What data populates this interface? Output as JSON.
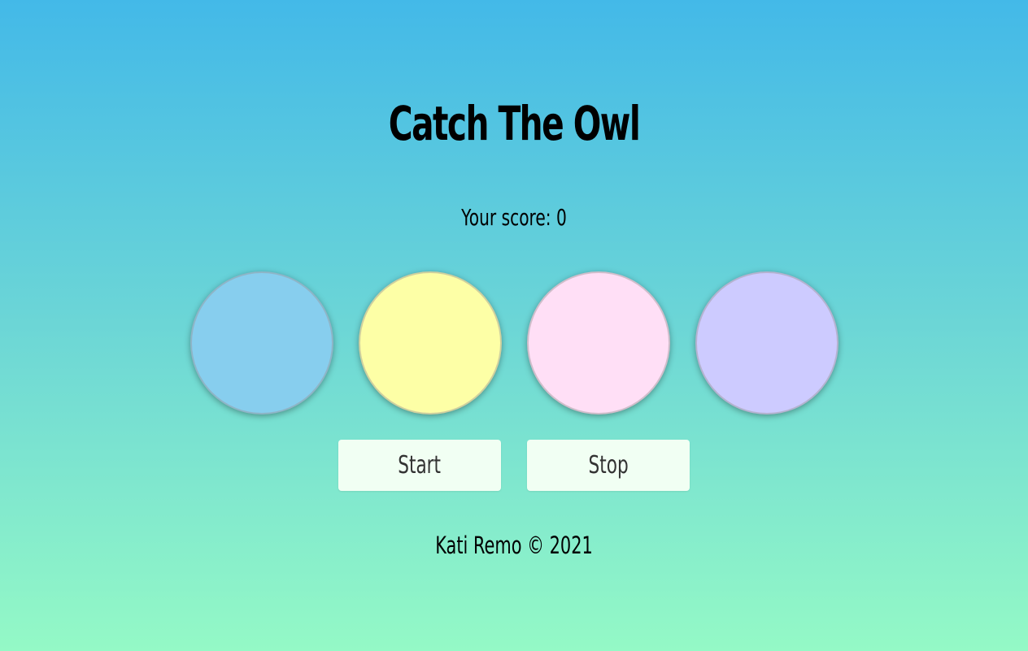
{
  "game": {
    "title": "Catch The Owl",
    "score_label": "Your score:",
    "score_value": 0,
    "circles": [
      {
        "color": "#87ceee"
      },
      {
        "color": "#fdffa6"
      },
      {
        "color": "#ffdff6"
      },
      {
        "color": "#cdcbff"
      }
    ],
    "buttons": {
      "start_label": "Start",
      "stop_label": "Stop"
    },
    "footer": "Kati Remo © 2021"
  },
  "colors": {
    "background_top": "#43b9e8",
    "background_bottom": "#94f9c6",
    "button_bg": "#f1fff3"
  }
}
